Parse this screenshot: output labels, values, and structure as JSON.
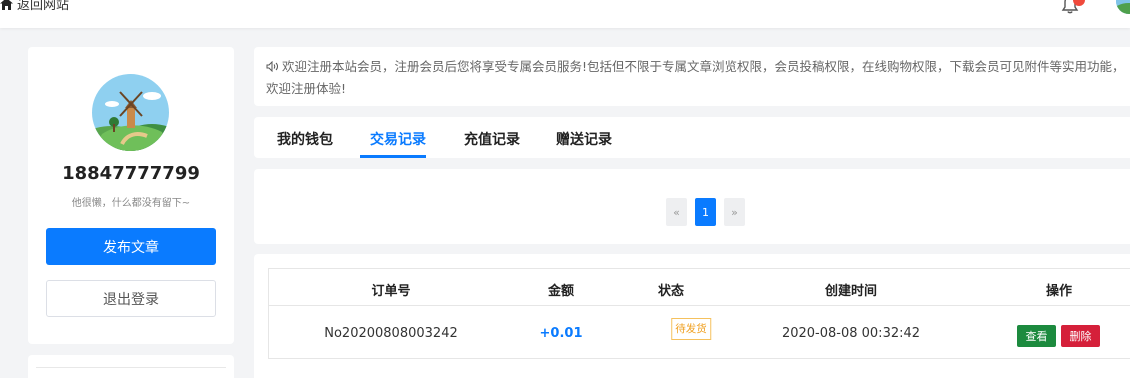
{
  "topbar": {
    "back_label": "返回网站"
  },
  "sidebar": {
    "username": "18847777799",
    "bio": "他很懒，什么都没有留下~",
    "publish_label": "发布文章",
    "logout_label": "退出登录"
  },
  "notice": {
    "text": "欢迎注册本站会员，注册会员后您将享受专属会员服务!包括但不限于专属文章浏览权限，会员投稿权限，在线购物权限，下载会员可见附件等实用功能，欢迎注册体验!"
  },
  "tabs": [
    {
      "label": "我的钱包"
    },
    {
      "label": "交易记录"
    },
    {
      "label": "充值记录"
    },
    {
      "label": "赠送记录"
    }
  ],
  "active_tab": "交易记录",
  "pager": {
    "prev": "«",
    "current": "1",
    "next": "»"
  },
  "table": {
    "headers": [
      "订单号",
      "金额",
      "状态",
      "创建时间",
      "操作"
    ],
    "rows": [
      {
        "order_no": "No20200808003242",
        "amount": "+0.01",
        "status": "待发货",
        "created": "2020-08-08 00:32:42",
        "view_label": "查看",
        "delete_label": "删除"
      }
    ]
  },
  "colors": {
    "accent": "#0a7bff",
    "view_button": "#1c8a3e",
    "delete_button": "#d5203a",
    "status_pending": "#f0a020",
    "notification_dot": "#f04a3c"
  },
  "icons": [
    "home-icon",
    "bell-icon",
    "speaker-icon",
    "avatar-windmill"
  ]
}
